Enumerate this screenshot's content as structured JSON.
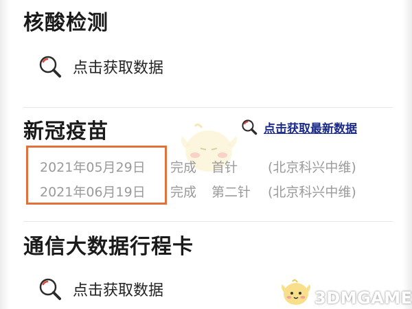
{
  "nucleic_test": {
    "title": "核酸检测",
    "fetch_label": "点击获取数据"
  },
  "vaccine": {
    "title": "新冠疫苗",
    "fetch_latest_label": "点击获取最新数据",
    "records": [
      {
        "date": "2021年05月29日",
        "status": "完成",
        "dose": "首针",
        "maker": "(北京科兴中维)"
      },
      {
        "date": "2021年06月19日",
        "status": "完成",
        "dose": "第二针",
        "maker": "(北京科兴中维)"
      }
    ]
  },
  "travel_card": {
    "title": "通信大数据行程卡",
    "fetch_label": "点击获取数据"
  },
  "watermark": {
    "text": "3DMGAME"
  },
  "colors": {
    "highlight_border": "#e1703a",
    "link": "#1a2a8c",
    "muted_text": "#9a9a9a"
  },
  "icons": [
    "search-icon",
    "mascot-icon",
    "logo-mascot-icon"
  ]
}
